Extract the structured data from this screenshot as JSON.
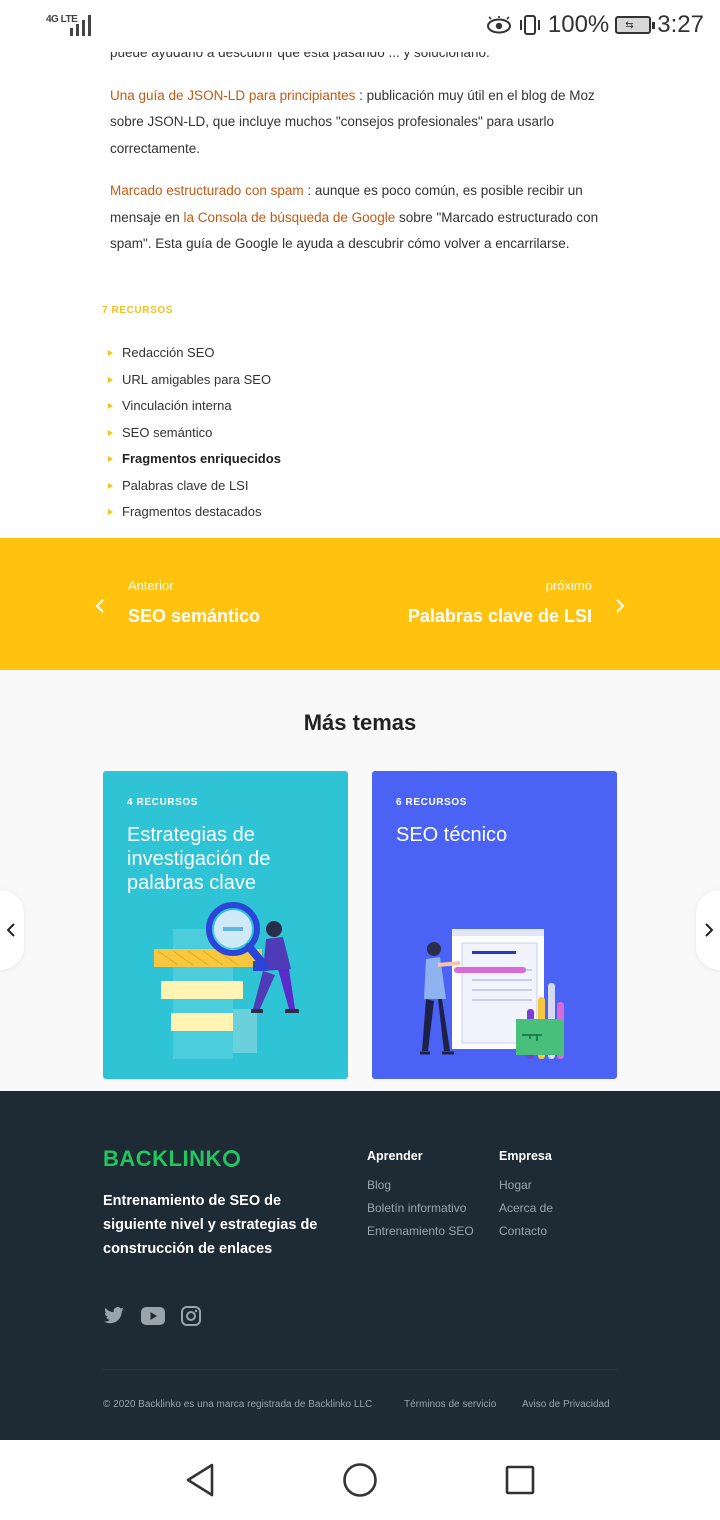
{
  "status_bar": {
    "network": "4G LTE",
    "battery": "100%",
    "time": "3:27"
  },
  "article": {
    "partial_line": "puede ayudarlo a descubrir qué está pasando ... y solucionarlo.",
    "para1_link": "Una guía de JSON-LD para principiantes",
    "para1_rest": " : publicación muy útil en el blog de Moz sobre JSON-LD, que incluye muchos \"consejos profesionales\" para usarlo correctamente.",
    "para2_link": "Marcado estructurado con spam",
    "para2_mid": " : aunque es poco común, es posible recibir un mensaje en ",
    "para2_link2": "la Consola de búsqueda de Google",
    "para2_rest": " sobre \"Marcado estructurado con spam\". Esta guía de Google le ayuda a descubrir cómo volver a encarrilarse."
  },
  "resources": {
    "label": "7 RECURSOS",
    "items": [
      "Redacción SEO",
      "URL amigables para SEO",
      "Vinculación interna",
      "SEO semántico",
      "Fragmentos enriquecidos",
      "Palabras clave de LSI",
      "Fragmentos destacados"
    ],
    "active_index": 4
  },
  "post_nav": {
    "prev_label": "Anterior",
    "prev_title": "SEO semántico",
    "next_label": "próximo",
    "next_title": "Palabras clave de LSI"
  },
  "more_topics": {
    "title": "Más temas",
    "cards": [
      {
        "count": "4 RECURSOS",
        "title": "Estrategias de investigación de palabras clave",
        "color": "#2ec4d6"
      },
      {
        "count": "6 RECURSOS",
        "title": "SEO técnico",
        "color": "#4b63f5"
      }
    ]
  },
  "footer": {
    "brand": "BACKLINK",
    "tagline": "Entrenamiento de SEO de siguiente nivel y estrategias de construcción de enlaces",
    "col1_title": "Aprender",
    "col1_links": [
      "Blog",
      "Boletín informativo",
      "Entrenamiento SEO"
    ],
    "col2_title": "Empresa",
    "col2_links": [
      "Hogar",
      "Acerca de",
      "Contacto"
    ],
    "social_icons": [
      "twitter-icon",
      "youtube-icon",
      "instagram-icon"
    ],
    "copyright": "© 2020 Backlinko es una marca registrada de Backlinko LLC",
    "terms": "Términos de servicio",
    "privacy": "Aviso de Privacidad"
  },
  "colors": {
    "accent_yellow": "#ffc20e",
    "link_orange": "#c35a13",
    "brand_green": "#22c55e",
    "footer_bg": "#1e2a34"
  }
}
